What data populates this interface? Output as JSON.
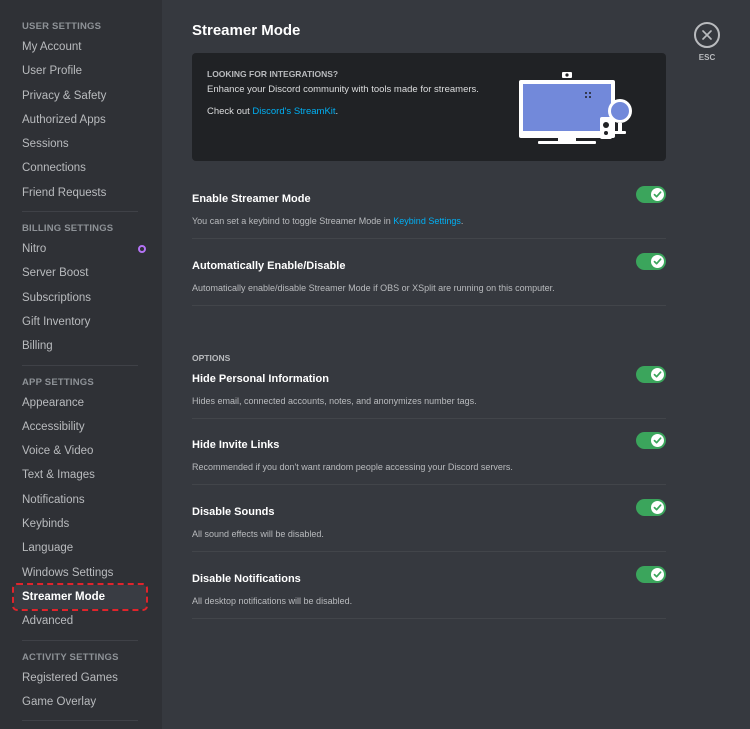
{
  "sidebar": {
    "sections": [
      {
        "header": "USER SETTINGS",
        "items": [
          {
            "label": "My Account"
          },
          {
            "label": "User Profile"
          },
          {
            "label": "Privacy & Safety"
          },
          {
            "label": "Authorized Apps"
          },
          {
            "label": "Sessions"
          },
          {
            "label": "Connections"
          },
          {
            "label": "Friend Requests"
          }
        ]
      },
      {
        "header": "BILLING SETTINGS",
        "items": [
          {
            "label": "Nitro"
          },
          {
            "label": "Server Boost"
          },
          {
            "label": "Subscriptions"
          },
          {
            "label": "Gift Inventory"
          },
          {
            "label": "Billing"
          }
        ]
      },
      {
        "header": "APP SETTINGS",
        "items": [
          {
            "label": "Appearance"
          },
          {
            "label": "Accessibility"
          },
          {
            "label": "Voice & Video"
          },
          {
            "label": "Text & Images"
          },
          {
            "label": "Notifications"
          },
          {
            "label": "Keybinds"
          },
          {
            "label": "Language"
          },
          {
            "label": "Windows Settings"
          },
          {
            "label": "Streamer Mode"
          },
          {
            "label": "Advanced"
          }
        ]
      },
      {
        "header": "ACTIVITY SETTINGS",
        "items": [
          {
            "label": "Registered Games"
          },
          {
            "label": "Game Overlay"
          }
        ]
      }
    ],
    "selected": "Streamer Mode"
  },
  "page": {
    "title": "Streamer Mode"
  },
  "banner": {
    "heading": "LOOKING FOR INTEGRATIONS?",
    "text": "Enhance your Discord community with tools made for streamers.",
    "check_prefix": "Check out ",
    "link": "Discord's StreamKit",
    "check_suffix": "."
  },
  "settings": {
    "enable": {
      "title": "Enable Streamer Mode",
      "desc_prefix": "You can set a keybind to toggle Streamer Mode in ",
      "desc_link": "Keybind Settings",
      "desc_suffix": ".",
      "enabled": true
    },
    "auto": {
      "title": "Automatically Enable/Disable",
      "desc": "Automatically enable/disable Streamer Mode if OBS or XSplit are running on this computer.",
      "enabled": true
    },
    "options_header": "OPTIONS",
    "hide_personal": {
      "title": "Hide Personal Information",
      "desc": "Hides email, connected accounts, notes, and anonymizes number tags.",
      "enabled": true
    },
    "hide_invite": {
      "title": "Hide Invite Links",
      "desc": "Recommended if you don't want random people accessing your Discord servers.",
      "enabled": true
    },
    "disable_sounds": {
      "title": "Disable Sounds",
      "desc": "All sound effects will be disabled.",
      "enabled": true
    },
    "disable_notifications": {
      "title": "Disable Notifications",
      "desc": "All desktop notifications will be disabled.",
      "enabled": true
    }
  },
  "close": {
    "label": "ESC"
  },
  "colors": {
    "toggle_on": "#3ba55c",
    "link": "#00b0f4",
    "selected_outline": "#e0242b",
    "nitro": "#b473f5"
  }
}
